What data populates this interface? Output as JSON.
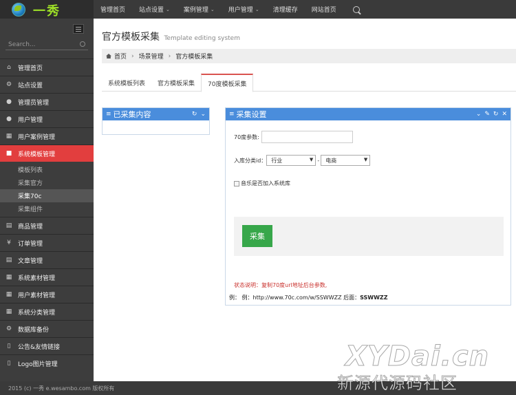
{
  "brand": {
    "logo_text": "一秀"
  },
  "topnav": {
    "items": [
      {
        "label": "管理首页",
        "caret": false
      },
      {
        "label": "站点设置",
        "caret": true
      },
      {
        "label": "案例管理",
        "caret": true
      },
      {
        "label": "用户管理",
        "caret": true
      },
      {
        "label": "清理缓存",
        "caret": false
      },
      {
        "label": "网站首页",
        "caret": false
      }
    ],
    "search_icon": "search-icon"
  },
  "sidebar": {
    "search_placeholder": "Search...",
    "items": [
      {
        "label": "管理首页",
        "icon": "home-icon",
        "glyph": "⌂"
      },
      {
        "label": "站点设置",
        "icon": "cogs-icon",
        "glyph": "⚙"
      },
      {
        "label": "管理员管理",
        "icon": "user-icon",
        "glyph": "●"
      },
      {
        "label": "用户管理",
        "icon": "user-icon",
        "glyph": "●"
      },
      {
        "label": "用户案例管理",
        "icon": "table-icon",
        "glyph": "▦"
      },
      {
        "label": "系统模板管理",
        "icon": "briefcase-icon",
        "glyph": "■",
        "active": true
      }
    ],
    "submenu": [
      {
        "label": "模板列表"
      },
      {
        "label": "采集官方"
      },
      {
        "label": "采集70c",
        "current": true
      },
      {
        "label": "采集组件"
      }
    ],
    "items_after": [
      {
        "label": "商品管理",
        "icon": "list-icon",
        "glyph": "▤"
      },
      {
        "label": "订单管理",
        "icon": "yen-icon",
        "glyph": "¥"
      },
      {
        "label": "文章管理",
        "icon": "list-icon",
        "glyph": "▤"
      },
      {
        "label": "系统素材管理",
        "icon": "th-icon",
        "glyph": "▦"
      },
      {
        "label": "用户素材管理",
        "icon": "th-icon",
        "glyph": "▦"
      },
      {
        "label": "系统分类管理",
        "icon": "th-icon",
        "glyph": "▦"
      },
      {
        "label": "数据库备份",
        "icon": "cogs-icon",
        "glyph": "⚙"
      },
      {
        "label": "公告&友情链接",
        "icon": "bookmark-icon",
        "glyph": "▯"
      },
      {
        "label": "Logo图片管理",
        "icon": "bookmark-icon",
        "glyph": "▯"
      }
    ]
  },
  "page": {
    "title": "官方模板采集",
    "subtitle": "Template editing system",
    "breadcrumb": [
      "首页",
      "场景管理",
      "官方模板采集"
    ],
    "tabs": [
      {
        "label": "系统模板列表"
      },
      {
        "label": "官方模板采集"
      },
      {
        "label": "70度模板采集",
        "active": true
      }
    ]
  },
  "left_box": {
    "title": "已采集内容"
  },
  "right_box": {
    "title": "采集设置",
    "param_label": "70度参数:",
    "param_value": "",
    "category_label": "入库分类id：",
    "select1": "行业",
    "dash": "-",
    "select2": "电商",
    "music_label": "音乐是否加入系统库",
    "collect_button": "采集",
    "hint": "状态说明：复制70度url地址后台参数,",
    "example_prefix": "例： 例：http://www.70c.com/w/SSWWZZ 后面：",
    "example_code": "SSWWZZ"
  },
  "footer": {
    "text": "2015 (c) 一秀 e.wesambo.com 版权所有"
  },
  "watermark": {
    "line1": "XYDai.cn",
    "line2": "新源代源码社区"
  }
}
